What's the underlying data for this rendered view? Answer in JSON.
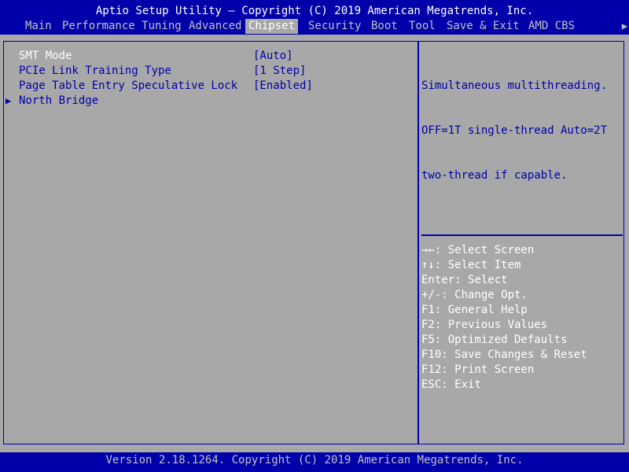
{
  "title": "Aptio Setup Utility – Copyright (C) 2019 American Megatrends, Inc.",
  "menu": {
    "items": [
      {
        "label": "Main"
      },
      {
        "label": "Performance Tuning"
      },
      {
        "label": "Advanced"
      },
      {
        "label": "Chipset"
      },
      {
        "label": "Security"
      },
      {
        "label": "Boot"
      },
      {
        "label": "Tool"
      },
      {
        "label": "Save & Exit"
      },
      {
        "label": "AMD CBS"
      }
    ],
    "active": "Chipset",
    "more_icon": "right-arrow-icon"
  },
  "options": [
    {
      "label": "SMT Mode",
      "value": "[Auto]"
    },
    {
      "label": "PCIe Link Training Type",
      "value": "[1 Step]"
    },
    {
      "label": "Page Table Entry Speculative Lock",
      "value": "[Enabled]"
    },
    {
      "label": "North Bridge",
      "value": ""
    }
  ],
  "help": {
    "lines": [
      "Simultaneous multithreading.",
      "OFF=1T single-thread Auto=2T",
      "two-thread if capable."
    ]
  },
  "keys": [
    {
      "key": "→←",
      "desc": ": Select Screen"
    },
    {
      "key": "↑↓",
      "desc": ": Select Item"
    },
    {
      "key": "Enter",
      "desc": ": Select"
    },
    {
      "key": "+/-",
      "desc": ": Change Opt."
    },
    {
      "key": "F1",
      "desc": ": General Help"
    },
    {
      "key": "F2",
      "desc": ": Previous Values"
    },
    {
      "key": "F5",
      "desc": ": Optimized Defaults"
    },
    {
      "key": "F10",
      "desc": ": Save Changes & Reset"
    },
    {
      "key": "F12",
      "desc": ": Print Screen"
    },
    {
      "key": "ESC",
      "desc": ": Exit"
    }
  ],
  "footer": "Version 2.18.1264. Copyright (C) 2019 American Megatrends, Inc.",
  "colors": {
    "background": "#0000aa",
    "panel": "#a8a8a8",
    "highlight_text": "#ffffff",
    "menu_text": "#c0c0c0"
  }
}
